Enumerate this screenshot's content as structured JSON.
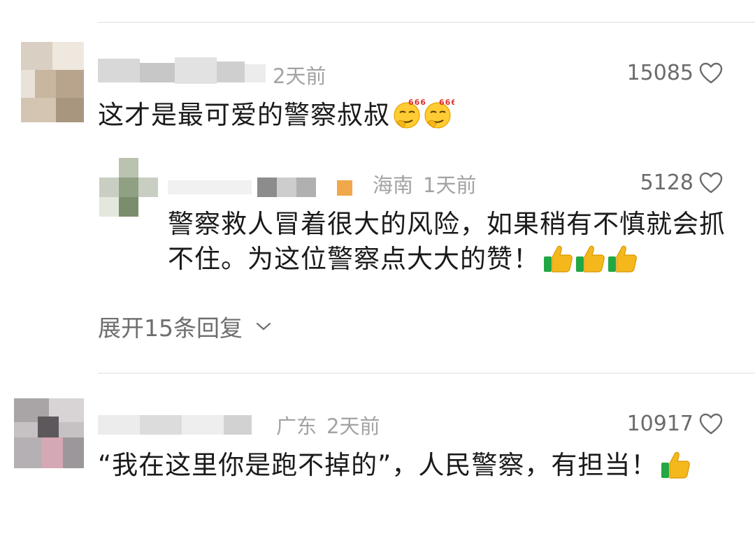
{
  "comments": [
    {
      "time": "2天前",
      "likes": "15085",
      "text": "这才是最可爱的警察叔叔",
      "emoji": "thinking-666-emoji"
    },
    {
      "location": "海南",
      "time": "1天前",
      "likes": "5128",
      "text": "警察救人冒着很大的风险，如果稍有不慎就会抓不住。为这位警察点大大的赞！",
      "emoji": "thumbs-up-emoji"
    },
    {
      "location": "广东",
      "time": "2天前",
      "likes": "10917",
      "text": "“我在这里你是跑不掉的”，人民警察，有担当！",
      "emoji": "thumbs-up-emoji"
    }
  ],
  "expand_replies_label": "展开15条回复",
  "colors": {
    "meta_gray": "#a3a3a3",
    "likes_gray": "#6b6b6b",
    "divider": "#ededed",
    "thumb_yellow": "#f5b81c",
    "thumb_green": "#22a745"
  }
}
